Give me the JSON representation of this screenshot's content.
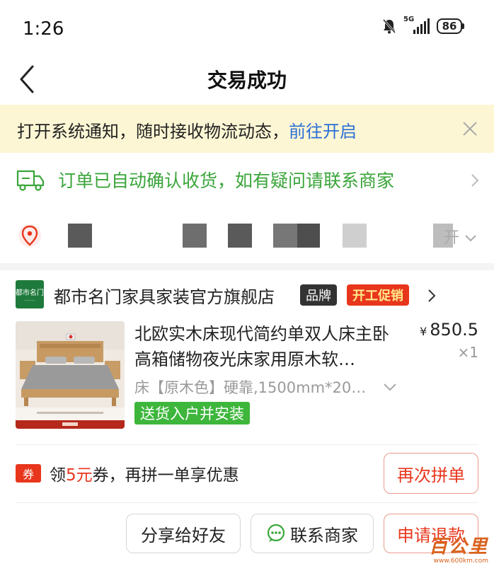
{
  "status_bar": {
    "time": "1:26",
    "network": "5G",
    "battery": "86"
  },
  "nav": {
    "title": "交易成功"
  },
  "notice": {
    "text": "打开系统通知，随时接收物流动态，",
    "link": "前往开启"
  },
  "delivery": {
    "text": "订单已自动确认收货，如有疑问请联系商家"
  },
  "address": {
    "tail": "开"
  },
  "shop": {
    "logo_text": "都市名门",
    "name": "都市名门家具家装官方旗舰店",
    "badge_brand": "品牌",
    "badge_promo": "开工促销"
  },
  "product": {
    "title": "北欧实木床现代简约单双人床主卧高箱储物夜光床家用原木软…",
    "currency": "¥",
    "price": "850.5",
    "quantity": "×1",
    "spec": "床【原木色】硬靠,1500mm*20…",
    "install_tag": "送货入户并安装"
  },
  "coupon": {
    "icon_label": "券",
    "text_before": "领",
    "amount": "5元",
    "text_after": "券，再拼一单享优惠",
    "button": "再次拼单"
  },
  "actions": {
    "share": "分享给好友",
    "contact": "联系商家",
    "refund": "申请退款"
  },
  "watermark": {
    "text": "百公里",
    "url": "www.600km.com"
  },
  "colors": {
    "accent_red": "#e8361c",
    "green": "#3aa53a",
    "link_blue": "#2b6fd6",
    "notice_bg": "#fdf6d4"
  }
}
